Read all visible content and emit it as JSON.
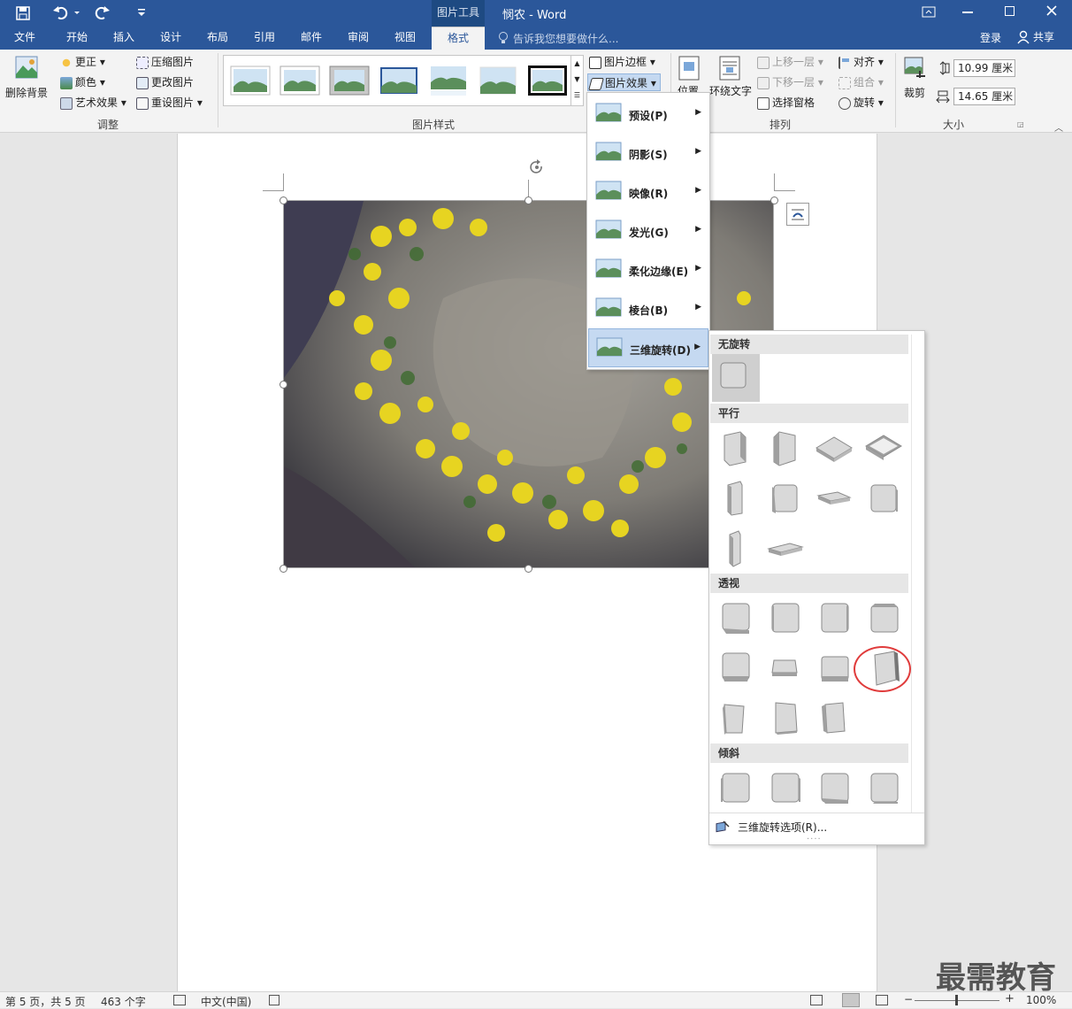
{
  "titlebar": {
    "context_tab": "图片工具",
    "doc_title": "悯农 - Word",
    "quick_access": [
      "save-icon",
      "undo-icon",
      "redo-icon",
      "customize-icon"
    ]
  },
  "tabs": [
    "文件",
    "开始",
    "插入",
    "设计",
    "布局",
    "引用",
    "邮件",
    "审阅",
    "视图",
    "格式"
  ],
  "tell_me": "告诉我您想要做什么...",
  "account": {
    "login": "登录",
    "share": "共享"
  },
  "ribbon": {
    "remove_bg": "删除背景",
    "adjust": {
      "correct": "更正",
      "color": "颜色",
      "artistic": "艺术效果",
      "compress": "压缩图片",
      "change": "更改图片",
      "reset": "重设图片",
      "group": "调整"
    },
    "styles_group": "图片样式",
    "border": "图片边框",
    "effects": "图片效果",
    "arrange": {
      "position": "位置",
      "wrap": "环绕文字",
      "forward": "上移一层",
      "backward": "下移一层",
      "pane": "选择窗格",
      "align": "对齐",
      "group_btn": "组合",
      "rotate": "旋转",
      "group": "排列"
    },
    "size": {
      "crop": "裁剪",
      "height": "10.99 厘米",
      "width": "14.65 厘米",
      "group": "大小"
    }
  },
  "effects_menu": [
    {
      "label": "预设(P)"
    },
    {
      "label": "阴影(S)"
    },
    {
      "label": "映像(R)"
    },
    {
      "label": "发光(G)"
    },
    {
      "label": "柔化边缘(E)"
    },
    {
      "label": "棱台(B)"
    },
    {
      "label": "三维旋转(D)"
    }
  ],
  "rotation_gallery": {
    "sections": [
      "无旋转",
      "平行",
      "透视",
      "倾斜"
    ],
    "options_link": "三维旋转选项(R)...",
    "dots": "....",
    "highlight_color": "#e03c3c"
  },
  "statusbar": {
    "page": "第 5 页，共 5 页",
    "words": "463 个字",
    "lang": "中文(中国)",
    "zoom": "100%"
  },
  "watermark": "最需教育",
  "colors": {
    "brand": "#2b579a",
    "menu_highlight": "#c5d9f1"
  }
}
